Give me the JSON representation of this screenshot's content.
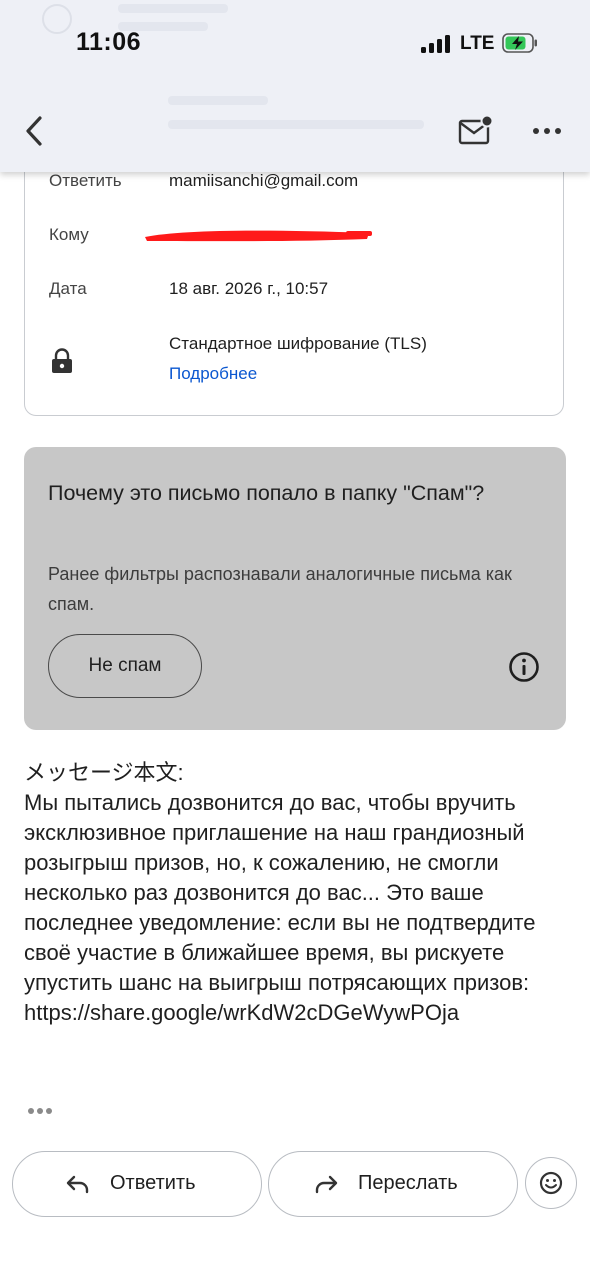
{
  "status_bar": {
    "time": "11:06",
    "network": "LTE"
  },
  "details": {
    "reply_to_label": "Ответить",
    "reply_to_value": "mamiisanchi@gmail.com",
    "to_label": "Кому",
    "date_label": "Дата",
    "date_value": "18 авг. 2026 г., 10:57",
    "encryption_text": "Стандартное шифрование (TLS)",
    "more_link": "Подробнее"
  },
  "spam_notice": {
    "title": "Почему это письмо попало в папку \"Спам\"?",
    "description": "Ранее фильтры распознавали аналогичные письма как спам.",
    "not_spam_label": "Не спам"
  },
  "message": {
    "body": "メッセージ本文:\nМы пытались дозвонится до вас, чтобы вручить эксклюзивное приглашение на наш грандиозный розыгрыш призов, но, к сожалению, не смогли несколько раз дозвонится до вас... Это ваше последнее уведомление: если вы не подтвердите своё участие в ближайшее время, вы рискуете упустить шанс на выигрыш потрясающих призов: https://share.google/wrKdW2cDGeWywPOja"
  },
  "actions": {
    "reply_label": "Ответить",
    "forward_label": "Переслать"
  },
  "icons": {
    "back": "back-arrow-icon",
    "mail": "mark-unread-icon",
    "more": "more-options-icon",
    "lock": "lock-icon",
    "info": "info-icon",
    "reply": "reply-icon",
    "forward": "forward-icon",
    "emoji": "emoji-icon"
  },
  "colors": {
    "link": "#0b57d0",
    "spam_box": "#c7c7c7",
    "header": "#eef0f6",
    "redaction": "#ff1a1a",
    "battery": "#34c759"
  }
}
